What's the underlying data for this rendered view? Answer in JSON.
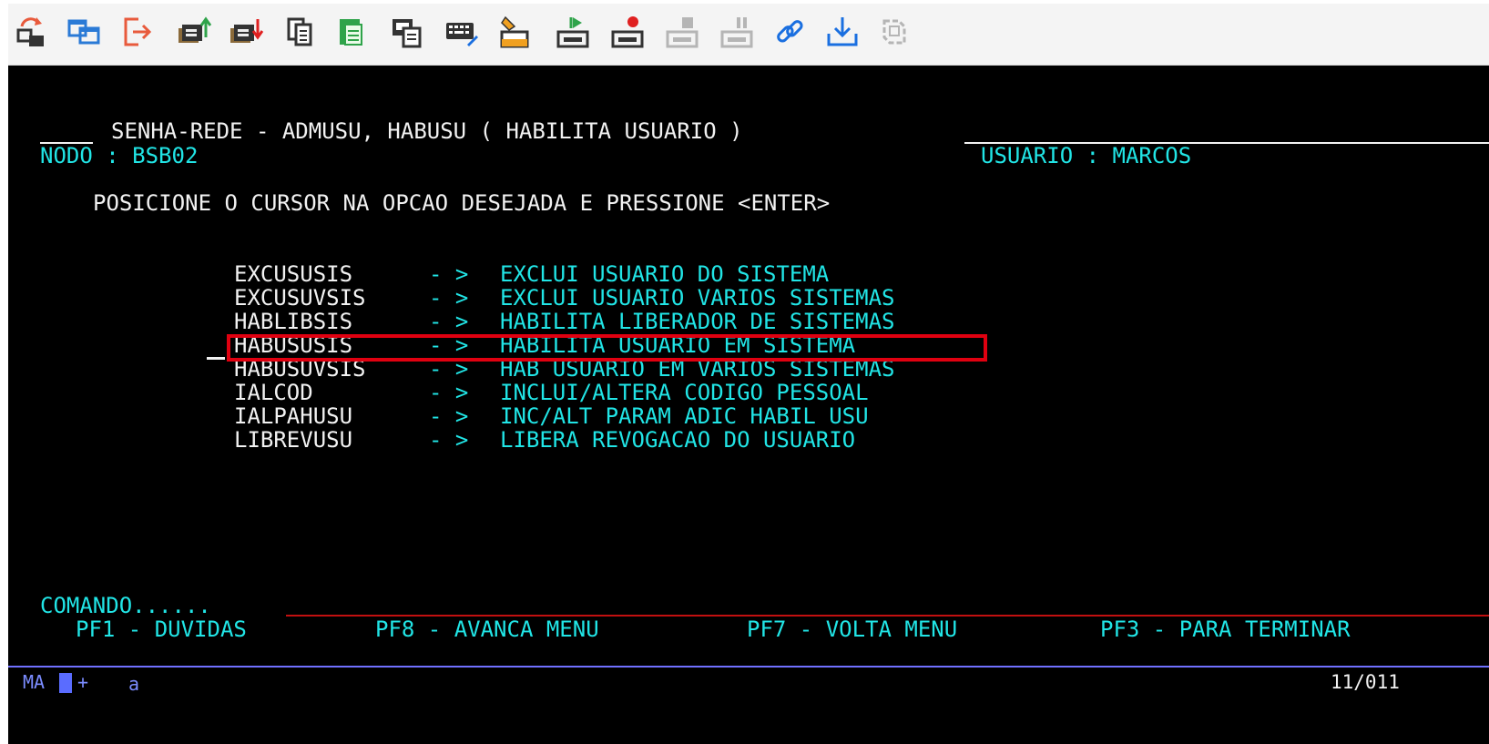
{
  "toolbar": {
    "icons": [
      {
        "name": "reconnect-session-icon",
        "color": "#e85a3c"
      },
      {
        "name": "new-session-icon",
        "color": "#2a7ad6"
      },
      {
        "name": "disconnect-icon",
        "color": "#e85a3c"
      },
      {
        "name": "send-file-icon",
        "color": "#333333"
      },
      {
        "name": "receive-file-icon",
        "color": "#333333"
      },
      {
        "name": "copy-icon",
        "color": "#333333"
      },
      {
        "name": "paste-icon",
        "color": "#2fa34a"
      },
      {
        "name": "copy-append-icon",
        "color": "#333333"
      },
      {
        "name": "keyboard-map-icon",
        "color": "#333333"
      },
      {
        "name": "clear-screen-icon",
        "color": "#f0a020"
      },
      {
        "name": "play-macro-icon",
        "color": "#2fa34a"
      },
      {
        "name": "record-macro-icon",
        "color": "#e02020"
      },
      {
        "name": "stop-macro-icon",
        "color": "#b5b5b5"
      },
      {
        "name": "pause-macro-icon",
        "color": "#b5b5b5"
      },
      {
        "name": "link-icon",
        "color": "#1a6fe0"
      },
      {
        "name": "download-icon",
        "color": "#1a6fe0"
      },
      {
        "name": "refresh-icon",
        "color": "#b5b5b5"
      }
    ]
  },
  "terminal": {
    "header": {
      "title": "SENHA-REDE - ADMUSU, HABUSU ( HABILITA USUARIO )",
      "node_label": "NODO : BSB02",
      "user_label": "USUARIO : MARCOS"
    },
    "instruction": "POSICIONE O CURSOR NA OPCAO DESEJADA E PRESSIONE <ENTER>",
    "arrow": "- >",
    "menu": [
      {
        "code": "EXCUSUSIS",
        "description": "EXCLUI USUARIO DO SISTEMA"
      },
      {
        "code": "EXCUSUVSIS",
        "description": "EXCLUI USUARIO VARIOS SISTEMAS"
      },
      {
        "code": "HABLIBSIS",
        "description": "HABILITA LIBERADOR DE SISTEMAS"
      },
      {
        "code": "HABUSUSIS",
        "description": "HABILITA USUARIO EM SISTEMA"
      },
      {
        "code": "HABUSUVSIS",
        "description": "HAB USUARIO EM VARIOS SISTEMAS"
      },
      {
        "code": "IALCOD",
        "description": "INCLUI/ALTERA CODIGO PESSOAL"
      },
      {
        "code": "IALPAHUSU",
        "description": "INC/ALT PARAM ADIC HABIL USU"
      },
      {
        "code": "LIBREVUSU",
        "description": "LIBERA REVOGACAO DO USUARIO"
      }
    ],
    "selected_index": 3,
    "command_label": "COMANDO......",
    "pf_keys": [
      {
        "label": "PF1 - DUVIDAS"
      },
      {
        "label": "PF8 - AVANCA MENU"
      },
      {
        "label": "PF7 - VOLTA MENU"
      },
      {
        "label": "PF3 - PARA TERMINAR"
      }
    ],
    "status": {
      "mode": "MA",
      "plus": "+",
      "session": "a",
      "cursor_pos": "11/011"
    }
  },
  "colors": {
    "background": "#000000",
    "text_white": "#f2f2f2",
    "text_cyan": "#21e5e6",
    "highlight_box": "#e00010"
  }
}
